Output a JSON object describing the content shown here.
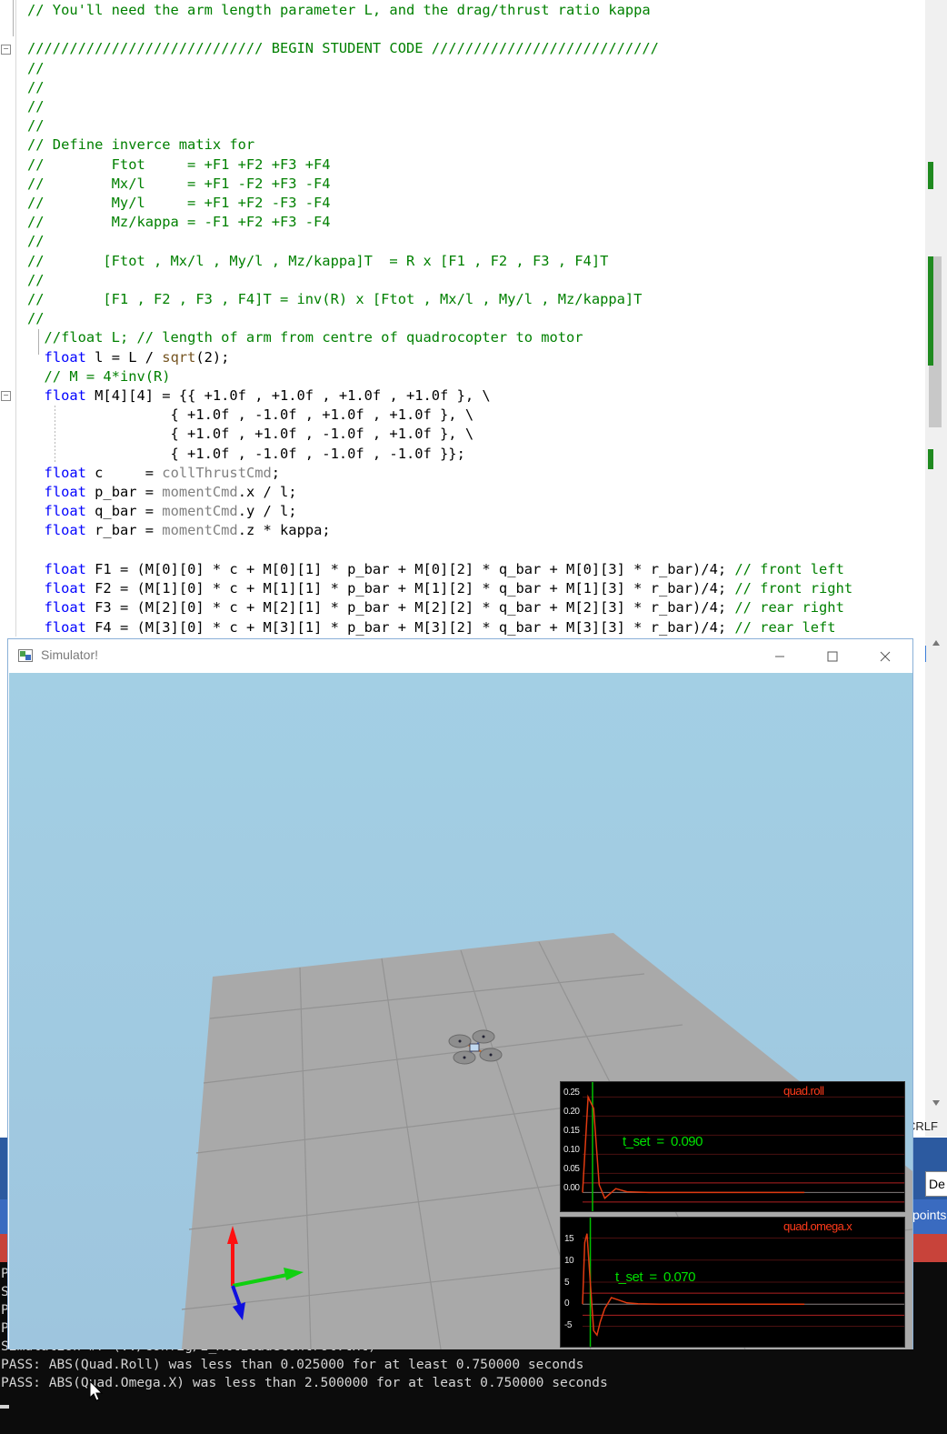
{
  "editor": {
    "code_lines": [
      [
        {
          "t": "c",
          "s": "// You'll need the arm length parameter L, and the drag/thrust ratio kappa"
        }
      ],
      [],
      [
        {
          "t": "c",
          "s": "//////////////////////////// BEGIN STUDENT CODE ///////////////////////////"
        }
      ],
      [
        {
          "t": "c",
          "s": "//"
        }
      ],
      [
        {
          "t": "c",
          "s": "//"
        }
      ],
      [
        {
          "t": "c",
          "s": "//"
        }
      ],
      [
        {
          "t": "c",
          "s": "//"
        }
      ],
      [
        {
          "t": "c",
          "s": "// Define inverce matix for"
        }
      ],
      [
        {
          "t": "c",
          "s": "//        Ftot     = +F1 +F2 +F3 +F4"
        }
      ],
      [
        {
          "t": "c",
          "s": "//        Mx/l     = +F1 -F2 +F3 -F4"
        }
      ],
      [
        {
          "t": "c",
          "s": "//        My/l     = +F1 +F2 -F3 -F4"
        }
      ],
      [
        {
          "t": "c",
          "s": "//        Mz/kappa = -F1 +F2 +F3 -F4"
        }
      ],
      [
        {
          "t": "c",
          "s": "//"
        }
      ],
      [
        {
          "t": "c",
          "s": "//       [Ftot , Mx/l , My/l , Mz/kappa]T  = R x [F1 , F2 , F3 , F4]T"
        }
      ],
      [
        {
          "t": "c",
          "s": "//"
        }
      ],
      [
        {
          "t": "c",
          "s": "//       [F1 , F2 , F3 , F4]T = inv(R) x [Ftot , Mx/l , My/l , Mz/kappa]T"
        }
      ],
      [
        {
          "t": "c",
          "s": "//"
        }
      ],
      [
        {
          "t": "n",
          "s": "  "
        },
        {
          "t": "c",
          "s": "//float L; // length of arm from centre of quadrocopter to motor"
        }
      ],
      [
        {
          "t": "n",
          "s": "  "
        },
        {
          "t": "k",
          "s": "float"
        },
        {
          "t": "n",
          "s": " l = L / "
        },
        {
          "t": "f",
          "s": "sqrt"
        },
        {
          "t": "n",
          "s": "(2);"
        }
      ],
      [
        {
          "t": "n",
          "s": "  "
        },
        {
          "t": "c",
          "s": "// M = 4*inv(R)"
        }
      ],
      [
        {
          "t": "n",
          "s": "  "
        },
        {
          "t": "k",
          "s": "float"
        },
        {
          "t": "n",
          "s": " M[4][4] = {{ +1.0f , +1.0f , +1.0f , +1.0f }, \\"
        }
      ],
      [
        {
          "t": "n",
          "s": "                 { +1.0f , -1.0f , +1.0f , +1.0f }, \\"
        }
      ],
      [
        {
          "t": "n",
          "s": "                 { +1.0f , +1.0f , -1.0f , +1.0f }, \\"
        }
      ],
      [
        {
          "t": "n",
          "s": "                 { +1.0f , -1.0f , -1.0f , -1.0f }};"
        }
      ],
      [
        {
          "t": "n",
          "s": "  "
        },
        {
          "t": "k",
          "s": "float"
        },
        {
          "t": "n",
          "s": " c     = "
        },
        {
          "t": "g",
          "s": "collThrustCmd"
        },
        {
          "t": "n",
          "s": ";"
        }
      ],
      [
        {
          "t": "n",
          "s": "  "
        },
        {
          "t": "k",
          "s": "float"
        },
        {
          "t": "n",
          "s": " p_bar = "
        },
        {
          "t": "g",
          "s": "momentCmd"
        },
        {
          "t": "n",
          "s": ".x / l;"
        }
      ],
      [
        {
          "t": "n",
          "s": "  "
        },
        {
          "t": "k",
          "s": "float"
        },
        {
          "t": "n",
          "s": " q_bar = "
        },
        {
          "t": "g",
          "s": "momentCmd"
        },
        {
          "t": "n",
          "s": ".y / l;"
        }
      ],
      [
        {
          "t": "n",
          "s": "  "
        },
        {
          "t": "k",
          "s": "float"
        },
        {
          "t": "n",
          "s": " r_bar = "
        },
        {
          "t": "g",
          "s": "momentCmd"
        },
        {
          "t": "n",
          "s": ".z * kappa;"
        }
      ],
      [],
      [
        {
          "t": "n",
          "s": "  "
        },
        {
          "t": "k",
          "s": "float"
        },
        {
          "t": "n",
          "s": " F1 = (M[0][0] * c + M[0][1] * p_bar + M[0][2] * q_bar + M[0][3] * r_bar)/4; "
        },
        {
          "t": "c",
          "s": "// front left"
        }
      ],
      [
        {
          "t": "n",
          "s": "  "
        },
        {
          "t": "k",
          "s": "float"
        },
        {
          "t": "n",
          "s": " F2 = (M[1][0] * c + M[1][1] * p_bar + M[1][2] * q_bar + M[1][3] * r_bar)/4; "
        },
        {
          "t": "c",
          "s": "// front right"
        }
      ],
      [
        {
          "t": "n",
          "s": "  "
        },
        {
          "t": "k",
          "s": "float"
        },
        {
          "t": "n",
          "s": " F3 = (M[2][0] * c + M[2][1] * p_bar + M[2][2] * q_bar + M[2][3] * r_bar)/4; "
        },
        {
          "t": "c",
          "s": "// rear right"
        }
      ],
      [
        {
          "t": "n",
          "s": "  "
        },
        {
          "t": "k",
          "s": "float"
        },
        {
          "t": "n",
          "s": " F4 = (M[3][0] * c + M[3][1] * p_bar + M[3][2] * q_bar + M[3][3] * r_bar)/4; "
        },
        {
          "t": "c",
          "s": "// rear left"
        }
      ]
    ],
    "colors": {
      "comment": "#008000",
      "keyword": "#0000ff",
      "function": "#74531f",
      "member": "#808080"
    }
  },
  "ide": {
    "line_ending": "CRLF",
    "dropdown_value": "De",
    "field_label": ":",
    "panel_label": "points"
  },
  "console": {
    "lines": [
      "P",
      "S",
      "P",
      "P",
      "Simulation #7 (../config/2_AttitudeControl.txt)",
      "PASS: ABS(Quad.Roll) was less than 0.025000 for at least 0.750000 seconds",
      "PASS: ABS(Quad.Omega.X) was less than 2.500000 for at least 0.750000 seconds"
    ]
  },
  "simulator": {
    "title": "Simulator!",
    "icons": {
      "app": "simulator-app-icon",
      "minimize": "minimize-icon",
      "maximize": "maximize-icon",
      "close": "close-icon"
    },
    "colors": {
      "sky": "#a3cfe4",
      "floor": "#a8a8a8",
      "x_axis": "#00c000",
      "y_axis": "#ff0000",
      "z_axis": "#0000ff"
    }
  },
  "graphs": [
    {
      "title": "quad.roll",
      "t_set": "t_set  =  0.090",
      "y_ticks": [
        "0.25",
        "0.20",
        "0.15",
        "0.10",
        "0.05",
        "0.00"
      ],
      "chart_data": {
        "type": "line",
        "series": [
          {
            "name": "quad.roll",
            "color": "#e03a10"
          }
        ],
        "x": [
          0.0,
          0.05,
          0.1,
          0.15,
          0.2,
          0.3,
          0.4,
          0.6,
          0.8,
          1.0,
          1.5,
          2.0
        ],
        "values": [
          0.0,
          0.25,
          0.22,
          0.02,
          -0.015,
          0.01,
          0.002,
          0.0,
          0.0,
          0.0,
          0.0,
          0.0
        ],
        "ylim": [
          -0.03,
          0.27
        ],
        "xlim": [
          0,
          2.9
        ],
        "t_set_x": 0.09
      }
    },
    {
      "title": "quad.omega.x",
      "t_set": "t_set  =  0.070",
      "y_ticks": [
        "15",
        "10",
        "5",
        "0",
        "-5"
      ],
      "chart_data": {
        "type": "line",
        "series": [
          {
            "name": "quad.omega.x",
            "color": "#e03a10"
          }
        ],
        "x": [
          0.0,
          0.02,
          0.04,
          0.07,
          0.1,
          0.13,
          0.16,
          0.2,
          0.26,
          0.32,
          0.4,
          0.5,
          0.7,
          1.0,
          2.0
        ],
        "values": [
          0.0,
          14,
          16,
          5,
          -6,
          -7,
          -4,
          -1,
          1.5,
          1,
          0.3,
          0.1,
          0,
          0,
          0
        ],
        "ylim": [
          -8,
          18
        ],
        "xlim": [
          0,
          2.9
        ],
        "t_set_x": 0.07
      }
    }
  ]
}
